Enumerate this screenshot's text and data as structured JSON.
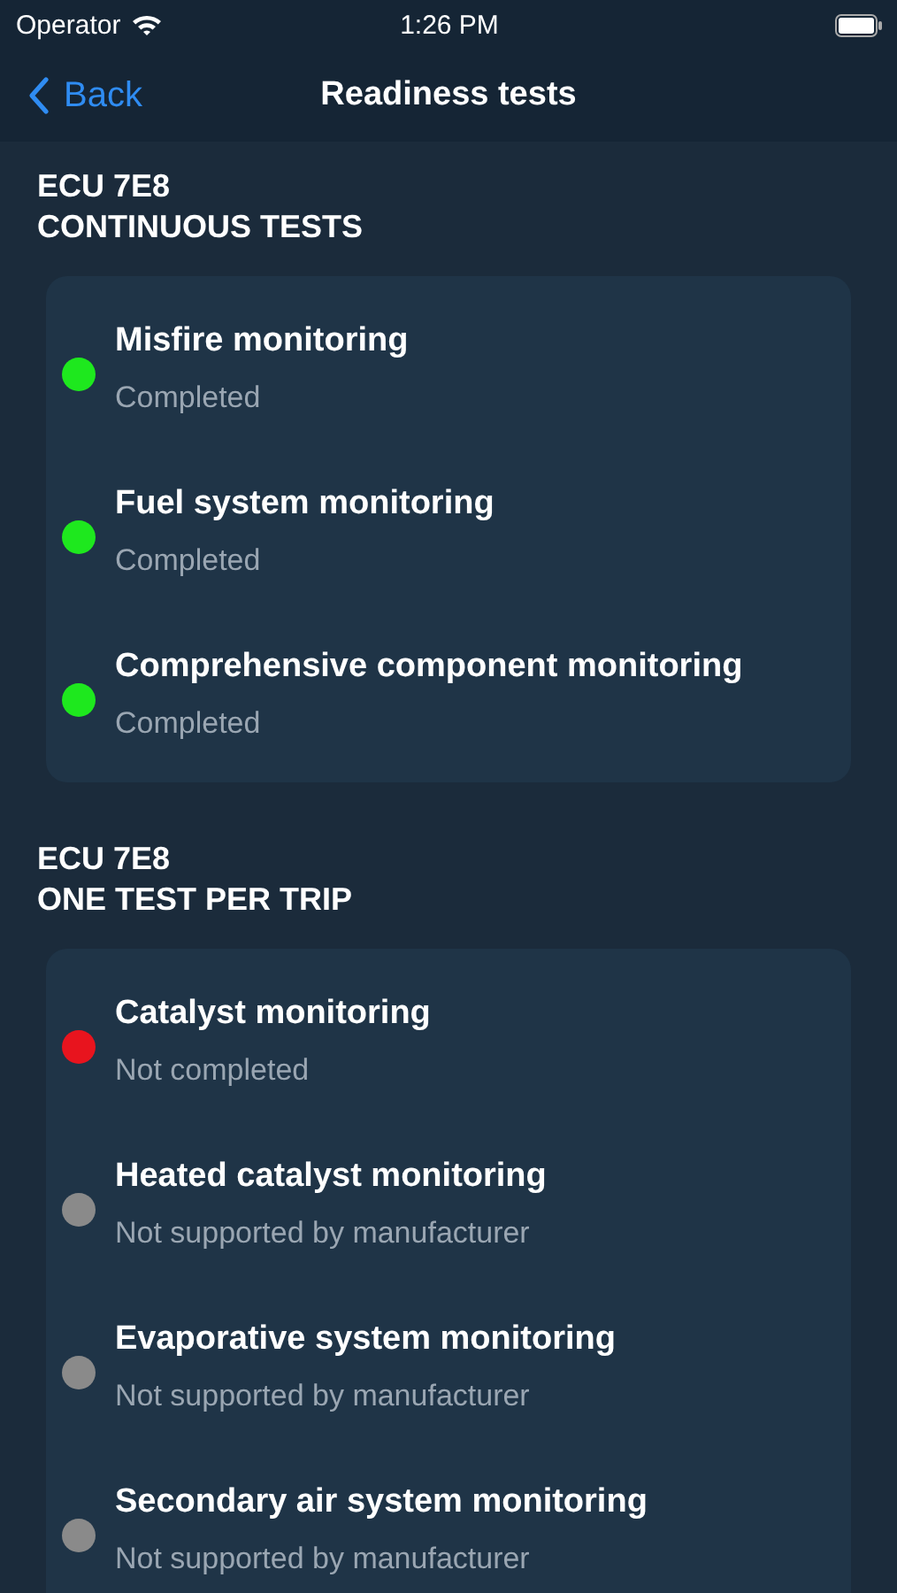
{
  "status_bar": {
    "carrier": "Operator",
    "time": "1:26 PM"
  },
  "nav": {
    "back": "Back",
    "title": "Readiness tests"
  },
  "sections": [
    {
      "ecu": "ECU 7E8",
      "title": "CONTINUOUS TESTS",
      "tests": [
        {
          "name": "Misfire monitoring",
          "status": "Completed",
          "color": "#1ee81e"
        },
        {
          "name": "Fuel system monitoring",
          "status": "Completed",
          "color": "#1ee81e"
        },
        {
          "name": "Comprehensive component monitoring",
          "status": "Completed",
          "color": "#1ee81e"
        }
      ]
    },
    {
      "ecu": "ECU 7E8",
      "title": "ONE TEST PER TRIP",
      "tests": [
        {
          "name": "Catalyst monitoring",
          "status": "Not completed",
          "color": "#e8141e"
        },
        {
          "name": "Heated catalyst monitoring",
          "status": "Not supported by manufacturer",
          "color": "#8a8a8a"
        },
        {
          "name": "Evaporative system monitoring",
          "status": "Not supported by manufacturer",
          "color": "#8a8a8a"
        },
        {
          "name": "Secondary air system monitoring",
          "status": "Not supported by manufacturer",
          "color": "#8a8a8a"
        }
      ]
    }
  ]
}
